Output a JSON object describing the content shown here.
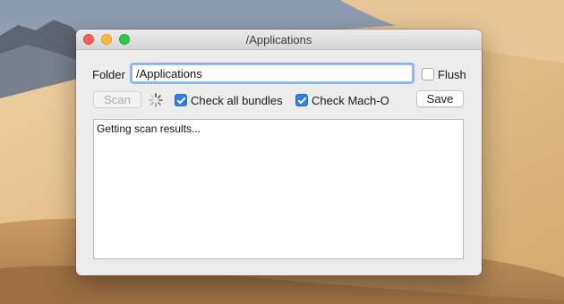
{
  "window": {
    "title": "/Applications"
  },
  "form": {
    "folder_label": "Folder",
    "folder_value": "/Applications",
    "flush_label": "Flush",
    "flush_checked": false,
    "scan_label": "Scan",
    "scan_enabled": false,
    "check_all_bundles_label": "Check all bundles",
    "check_all_bundles_checked": true,
    "check_macho_label": "Check Mach-O",
    "check_macho_checked": true,
    "save_label": "Save"
  },
  "results": {
    "text": "Getting scan results..."
  },
  "icons": {
    "close": "close-icon",
    "minimize": "minimize-icon",
    "zoom": "zoom-icon",
    "spinner": "spinner-icon"
  },
  "colors": {
    "accent": "#2f7de1",
    "close": "#fc605b",
    "minimize": "#fdbc40",
    "zoom": "#34c84a"
  }
}
